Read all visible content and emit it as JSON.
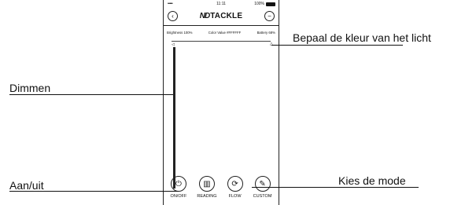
{
  "status": {
    "signal": "•••••",
    "time": "11:11",
    "battery": "100%"
  },
  "header": {
    "logo": "ND",
    "title": "TACKLE"
  },
  "info": {
    "brightness": "Brightness 100%",
    "color_value": "Color Value #FFFFFF",
    "battery": "Battery 68%"
  },
  "modes": [
    {
      "label": "ON/OFF",
      "icon": "power-icon"
    },
    {
      "label": "READING",
      "icon": "book-icon"
    },
    {
      "label": "FLOW",
      "icon": "refresh-icon"
    },
    {
      "label": "CUSTOM",
      "icon": "brush-icon"
    }
  ],
  "annotations": {
    "color": "Bepaal de kleur van het licht",
    "dim": "Dimmen",
    "power": "Aan/uit",
    "mode": "Kies de mode"
  }
}
